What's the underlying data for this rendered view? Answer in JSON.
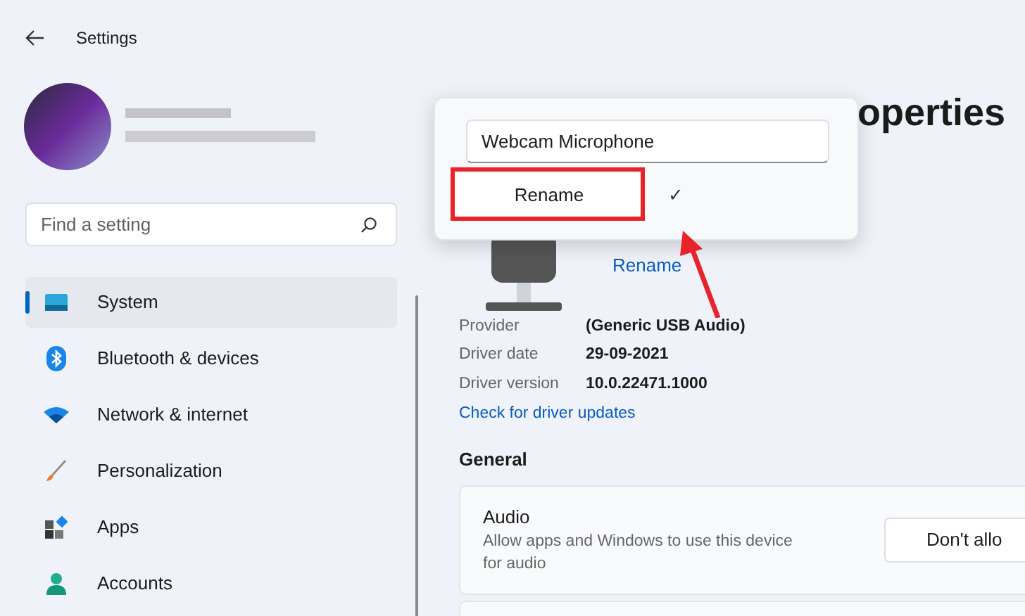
{
  "window": {
    "title": "Settings"
  },
  "search": {
    "placeholder": "Find a setting"
  },
  "sidebar": {
    "items": [
      {
        "label": "System",
        "kind": "system",
        "selected": true
      },
      {
        "label": "Bluetooth & devices",
        "kind": "bluetooth",
        "selected": false
      },
      {
        "label": "Network & internet",
        "kind": "network",
        "selected": false
      },
      {
        "label": "Personalization",
        "kind": "brush",
        "selected": false
      },
      {
        "label": "Apps",
        "kind": "apps",
        "selected": false
      },
      {
        "label": "Accounts",
        "kind": "accounts",
        "selected": false
      }
    ]
  },
  "page_title": "operties",
  "rename_link": "Rename",
  "properties": [
    {
      "label": "Provider",
      "value": "(Generic USB Audio)"
    },
    {
      "label": "Driver date",
      "value": "29-09-2021"
    },
    {
      "label": "Driver version",
      "value": "10.0.22471.1000"
    }
  ],
  "driver_link": "Check for driver updates",
  "section": "General",
  "audio_card": {
    "title": "Audio",
    "description": "Allow apps and Windows to use this device for audio",
    "button": "Don't allo"
  },
  "rename_popup": {
    "value": "Webcam Microphone",
    "button": "Rename",
    "confirm": "✓"
  }
}
